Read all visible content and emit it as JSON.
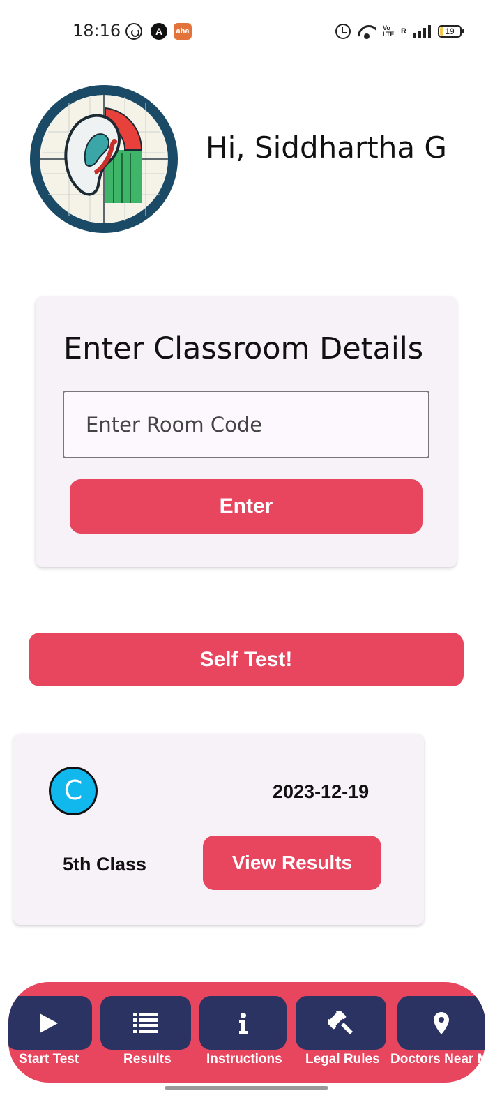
{
  "status_bar": {
    "time": "18:16",
    "aha_label": "aha",
    "a_label": "A",
    "volte_top": "Vo",
    "volte_bottom": "LTE",
    "roaming": "R",
    "battery_level": "19"
  },
  "header": {
    "greeting": "Hi, Siddhartha G",
    "logo_icon": "ear-hearing-test-logo"
  },
  "classroom": {
    "title": "Enter Classroom Details",
    "room_code_placeholder": "Enter Room Code",
    "room_code_value": "",
    "enter_label": "Enter"
  },
  "self_test_label": "Self Test!",
  "result_card": {
    "avatar_letter": "C",
    "date": "2023-12-19",
    "class_name": "5th Class",
    "view_results_label": "View Results"
  },
  "bottom_nav": {
    "items": [
      {
        "label": "Start Test",
        "icon": "play-icon"
      },
      {
        "label": "Results",
        "icon": "list-icon"
      },
      {
        "label": "Instructions",
        "icon": "info-icon"
      },
      {
        "label": "Legal Rules",
        "icon": "gavel-icon"
      },
      {
        "label": "Doctors Near M",
        "icon": "location-pin-icon"
      }
    ]
  },
  "colors": {
    "accent": "#e8455f",
    "nav_tile": "#2b3363",
    "card_bg": "#f7f2f8",
    "avatar": "#10b8ee"
  }
}
